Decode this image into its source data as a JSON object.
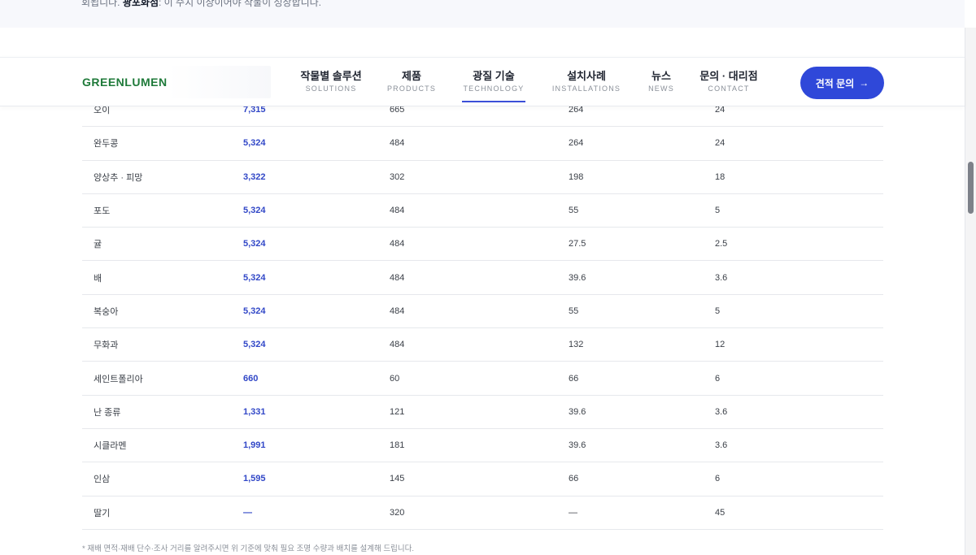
{
  "top_snippet": {
    "prefix": "회됩니다. ",
    "bold": "광포화점",
    "suffix": ": 이 수치 이상이어야 작물이 성장합니다."
  },
  "header": {
    "logo": "GREENLUMEN",
    "nav": [
      {
        "ko": "작물별 솔루션",
        "en": "SOLUTIONS"
      },
      {
        "ko": "제품",
        "en": "PRODUCTS"
      },
      {
        "ko": "광질 기술",
        "en": "TECHNOLOGY",
        "active": true
      },
      {
        "ko": "설치사례",
        "en": "INSTALLATIONS"
      },
      {
        "ko": "뉴스",
        "en": "NEWS"
      },
      {
        "ko": "문의 · 대리점",
        "en": "CONTACT"
      }
    ],
    "cta_label": "견적 문의",
    "cta_icon": "arrow-right-icon"
  },
  "table": {
    "rows": [
      [
        "오이",
        "7,315",
        "665",
        "264",
        "24"
      ],
      [
        "완두콩",
        "5,324",
        "484",
        "264",
        "24"
      ],
      [
        "양상추 · 피망",
        "3,322",
        "302",
        "198",
        "18"
      ],
      [
        "포도",
        "5,324",
        "484",
        "55",
        "5"
      ],
      [
        "귤",
        "5,324",
        "484",
        "27.5",
        "2.5"
      ],
      [
        "배",
        "5,324",
        "484",
        "39.6",
        "3.6"
      ],
      [
        "복숭아",
        "5,324",
        "484",
        "55",
        "5"
      ],
      [
        "무화과",
        "5,324",
        "484",
        "132",
        "12"
      ],
      [
        "세인트폴리아",
        "660",
        "60",
        "66",
        "6"
      ],
      [
        "난 종류",
        "1,331",
        "121",
        "39.6",
        "3.6"
      ],
      [
        "시클라멘",
        "1,991",
        "181",
        "39.6",
        "3.6"
      ],
      [
        "인삼",
        "1,595",
        "145",
        "66",
        "6"
      ],
      [
        "딸기",
        "—",
        "320",
        "—",
        "45"
      ]
    ]
  },
  "footnote": "* 재배 면적·재배 단수·조사 거리를 알려주시면 위 기준에 맞춰 필요 조명 수량과 배치를 설계해 드립니다.",
  "colors": {
    "brand_green": "#1f7a3a",
    "accent_blue": "#2f48d9",
    "value_blue": "#3147c7"
  }
}
